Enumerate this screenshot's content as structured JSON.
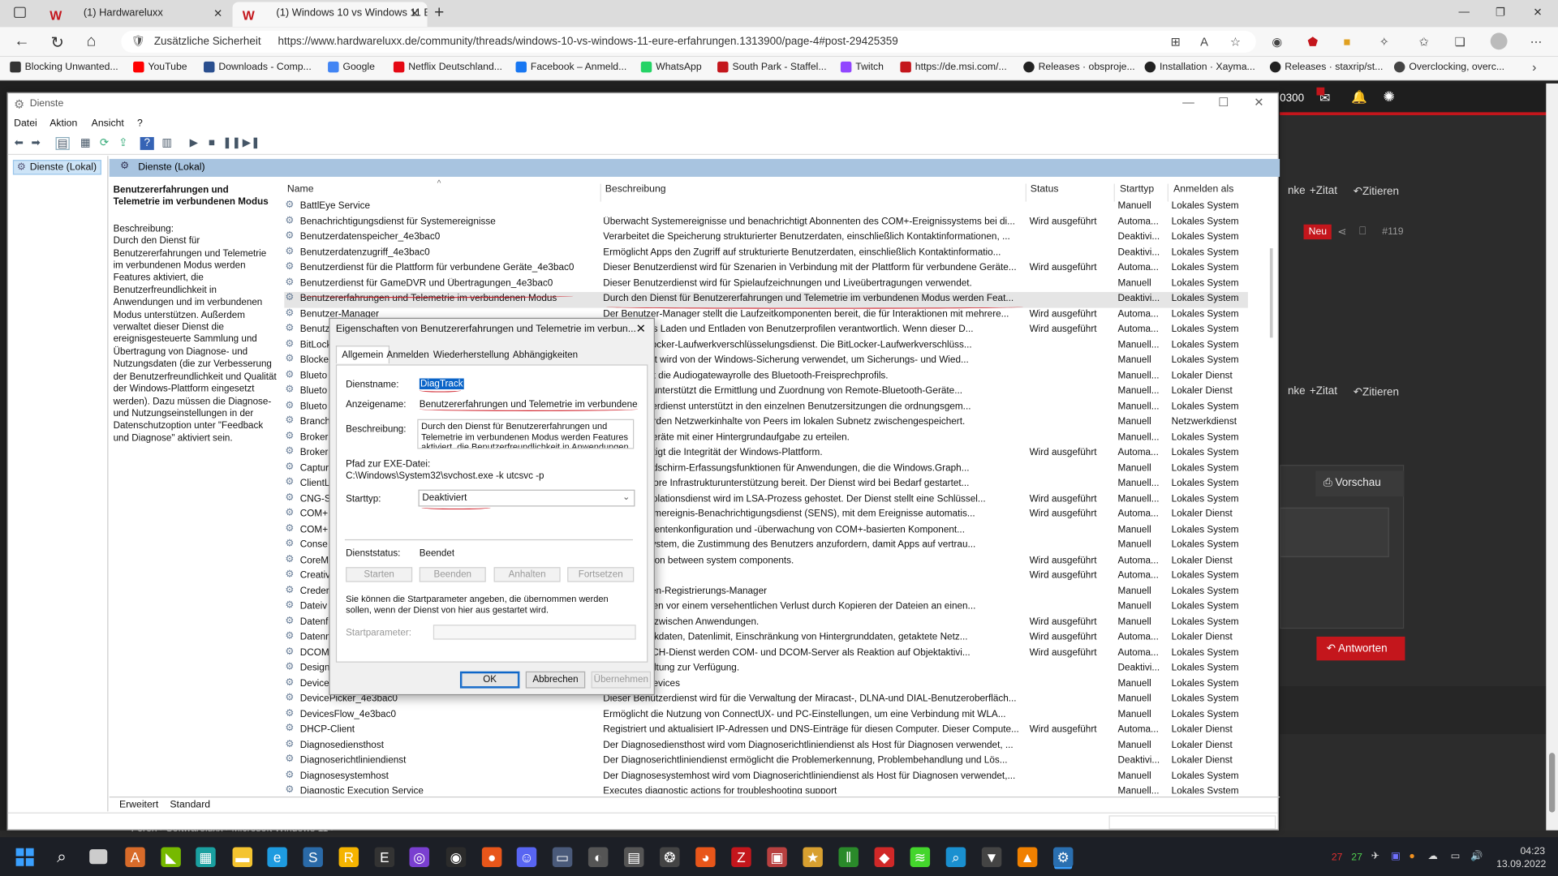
{
  "browser": {
    "tabs": [
      {
        "label": "(1) Hardwareluxx",
        "active": false
      },
      {
        "label": "(1) Windows 10 vs Windows 11 E",
        "active": true
      }
    ],
    "security_label": "Zusätzliche Sicherheit",
    "url": "https://www.hardwareluxx.de/community/threads/windows-10-vs-windows-11-eure-erfahrungen.1313900/page-4#post-29425359",
    "bookmarks": [
      {
        "label": "Blocking Unwanted...",
        "color": "#333333"
      },
      {
        "label": "YouTube",
        "color": "#ff0000"
      },
      {
        "label": "Downloads - Comp...",
        "color": "#2a4f8f"
      },
      {
        "label": "Google",
        "color": "#4285f4"
      },
      {
        "label": "Netflix Deutschland...",
        "color": "#e50914"
      },
      {
        "label": "Facebook – Anmeld...",
        "color": "#1877f2"
      },
      {
        "label": "WhatsApp",
        "color": "#25d366"
      },
      {
        "label": "South Park - Staffel...",
        "color": "#c4161c"
      },
      {
        "label": "Twitch",
        "color": "#9146ff"
      },
      {
        "label": "https://de.msi.com/...",
        "color": "#c4161c"
      },
      {
        "label": "Releases · obsproje...",
        "color": "#222222"
      },
      {
        "label": "Installation · Xayma...",
        "color": "#222222"
      },
      {
        "label": "Releases · staxrip/st...",
        "color": "#222222"
      },
      {
        "label": "Overclocking, overc...",
        "color": "#444444"
      }
    ]
  },
  "webpage": {
    "counter": "0300",
    "quote_label": "Zitat",
    "cite_label": "Zitieren",
    "partial_label": "nke",
    "new_badge": "Neu",
    "post_number": "#119",
    "preview_label": "Vorschau",
    "reply_label": "Antworten",
    "breadcrumb": "Foren  ›  Softwareluxx  ›  Microsoft Windows 11  ›"
  },
  "services": {
    "window_title": "Dienste",
    "menu": [
      "Datei",
      "Aktion",
      "Ansicht",
      "?"
    ],
    "tree_node": "Dienste (Lokal)",
    "pane_header": "Dienste (Lokal)",
    "selected_title": "Benutzererfahrungen und Telemetrie im verbundenen Modus",
    "description_label": "Beschreibung:",
    "description": "Durch den Dienst für Benutzererfahrungen und Telemetrie im verbundenen Modus werden Features aktiviert, die Benutzerfreundlichkeit in Anwendungen und im verbundenen Modus unterstützen. Außerdem verwaltet dieser Dienst die ereignisgesteuerte Sammlung und Übertragung von Diagnose- und Nutzungsdaten (die zur Verbesserung der Benutzerfreundlichkeit und Qualität der Windows-Plattform eingesetzt werden). Dazu müssen die Diagnose- und Nutzungseinstellungen in der Datenschutzoption unter \"Feedback und Diagnose\" aktiviert sein.",
    "columns": [
      "Name",
      "Beschreibung",
      "Status",
      "Starttyp",
      "Anmelden als"
    ],
    "rows": [
      {
        "name": "BattlEye Service",
        "desc": "",
        "status": "",
        "start": "Manuell",
        "logon": "Lokales System"
      },
      {
        "name": "Benachrichtigungsdienst für Systemereignisse",
        "desc": "Überwacht Systemereignisse und benachrichtigt Abonnenten des COM+-Ereignissystems bei di...",
        "status": "Wird ausgeführt",
        "start": "Automa...",
        "logon": "Lokales System"
      },
      {
        "name": "Benutzerdatenspeicher_4e3bac0",
        "desc": "Verarbeitet die Speicherung strukturierter Benutzerdaten, einschließlich Kontaktinformationen, ...",
        "status": "",
        "start": "Deaktivi...",
        "logon": "Lokales System"
      },
      {
        "name": "Benutzerdatenzugriff_4e3bac0",
        "desc": "Ermöglicht Apps den Zugriff auf strukturierte Benutzerdaten, einschließlich Kontaktinformatio...",
        "status": "",
        "start": "Deaktivi...",
        "logon": "Lokales System"
      },
      {
        "name": "Benutzerdienst für die Plattform für verbundene Geräte_4e3bac0",
        "desc": "Dieser Benutzerdienst wird für Szenarien in Verbindung mit der Plattform für verbundene Geräte...",
        "status": "Wird ausgeführt",
        "start": "Automa...",
        "logon": "Lokales System"
      },
      {
        "name": "Benutzerdienst für GameDVR und Übertragungen_4e3bac0",
        "desc": "Dieser Benutzerdienst wird für Spielaufzeichnungen und Liveübertragungen verwendet.",
        "status": "",
        "start": "Manuell",
        "logon": "Lokales System"
      },
      {
        "name": "Benutzererfahrungen und Telemetrie im verbundenen Modus",
        "desc": "Durch den Dienst für Benutzererfahrungen und Telemetrie im verbundenen Modus werden Feat...",
        "status": "",
        "start": "Deaktivi...",
        "logon": "Lokales System",
        "selected": true
      },
      {
        "name": "Benutzer-Manager",
        "desc": "Der Benutzer-Manager stellt die Laufzeitkomponenten bereit, die für Interaktionen mit mehrere...",
        "status": "Wird ausgeführt",
        "start": "Automa...",
        "logon": "Lokales System"
      },
      {
        "name": "Benutz",
        "desc": "...t ist für das Laden und Entladen von Benutzerprofilen verantwortlich. Wenn dieser D...",
        "status": "Wird ausgeführt",
        "start": "Automa...",
        "logon": "Lokales System"
      },
      {
        "name": "BitLock",
        "desc": "...t den BitLocker-Laufwerkverschlüsselungsdienst. Die BitLocker-Laufwerkverschlüss...",
        "status": "",
        "start": "Manuell...",
        "logon": "Lokales System"
      },
      {
        "name": "Blocke",
        "desc": "...INE-Dienst wird von der Windows-Sicherung verwendet, um Sicherungs- und Wied...",
        "status": "",
        "start": "Manuell",
        "logon": "Lokales System"
      },
      {
        "name": "Blueto",
        "desc": "...unterstützt die Audiogatewayrolle des Bluetooth-Freisprechprofils.",
        "status": "",
        "start": "Manuell...",
        "logon": "Lokaler Dienst"
      },
      {
        "name": "Blueto",
        "desc": "...th-Dienst unterstützt die Ermittlung und Zuordnung von Remote-Bluetooth-Geräte...",
        "status": "",
        "start": "Manuell...",
        "logon": "Lokaler Dienst"
      },
      {
        "name": "Blueto",
        "desc": "...th-Benutzerdienst unterstützt in den einzelnen Benutzersitzungen die ordnungsgem...",
        "status": "",
        "start": "Manuell...",
        "logon": "Lokales System"
      },
      {
        "name": "Branch",
        "desc": "...Dienst werden Netzwerkinhalte von Peers im lokalen Subnetz zwischengespeichert.",
        "status": "",
        "start": "Manuell",
        "logon": "Netzwerkdienst"
      },
      {
        "name": "Broker",
        "desc": "...s Apps, Geräte mit einer Hintergrundaufgabe zu erteilen.",
        "status": "",
        "start": "Manuell...",
        "logon": "Lokales System"
      },
      {
        "name": "Broker",
        "desc": "...und bestätigt die Integrität der Windows-Plattform.",
        "status": "Wird ausgeführt",
        "start": "Automa...",
        "logon": "Lokales System"
      },
      {
        "name": "Captur",
        "desc": "...tionale Bildschirm-Erfassungsfunktionen für Anwendungen, die die Windows.Graph...",
        "status": "",
        "start": "Manuell",
        "logon": "Lokales System"
      },
      {
        "name": "ClientL",
        "desc": "...icrosoft Store Infrastrukturunterstützung bereit. Der Dienst wird bei Bedarf gestartet...",
        "status": "",
        "start": "Manuell...",
        "logon": "Lokales System"
      },
      {
        "name": "CNG-S",
        "desc": "...chlüsselisolationsdienst wird im LSA-Prozess gehostet. Der Dienst stellt eine Schlüssel...",
        "status": "Wird ausgeführt",
        "start": "Manuell...",
        "logon": "Lokales System"
      },
      {
        "name": "COM+",
        "desc": "...den Systemereignis-Benachrichtigungsdienst (SENS), mit dem Ereignisse automatis...",
        "status": "Wird ausgeführt",
        "start": "Automa...",
        "logon": "Lokaler Dienst"
      },
      {
        "name": "COM+",
        "desc": "...e Komponentenkonfiguration und -überwachung von COM+-basierten Komponent...",
        "status": "",
        "start": "Manuell",
        "logon": "Lokales System"
      },
      {
        "name": "Conse",
        "desc": "...es dem System, die Zustimmung des Benutzers anzufordern, damit Apps auf vertrau...",
        "status": "",
        "start": "Manuell",
        "logon": "Lokales System"
      },
      {
        "name": "CoreM",
        "desc": "...mmunication between system components.",
        "status": "Wird ausgeführt",
        "start": "Automa...",
        "logon": "Lokaler Dienst"
      },
      {
        "name": "Creativ",
        "desc": "",
        "status": "Wird ausgeführt",
        "start": "Automa...",
        "logon": "Lokales System"
      },
      {
        "name": "Creder",
        "desc": "...formationen-Registrierungs-Manager",
        "status": "",
        "start": "Manuell",
        "logon": "Lokales System"
      },
      {
        "name": "Dateiv",
        "desc": "...utzerdateien vor einem versehentlichen Verlust durch Kopieren der Dateien an einen...",
        "status": "",
        "start": "Manuell",
        "logon": "Lokales System"
      },
      {
        "name": "Datenf",
        "desc": "...tenbroker zwischen Anwendungen.",
        "status": "Wird ausgeführt",
        "start": "Manuell",
        "logon": "Lokales System"
      },
      {
        "name": "Datenn",
        "desc": "...n Netzwerkdaten, Datenlimit, Einschränkung von Hintergrunddaten, getaktete Netz...",
        "status": "Wird ausgeführt",
        "start": "Automa...",
        "logon": "Lokaler Dienst"
      },
      {
        "name": "DCOM",
        "desc": "...OMLAUNCH-Dienst werden COM- und DCOM-Server als Reaktion auf Objektaktivi...",
        "status": "Wird ausgeführt",
        "start": "Automa...",
        "logon": "Lokales System"
      },
      {
        "name": "Design",
        "desc": "...signverwaltung zur Verfügung.",
        "status": "",
        "start": "Deaktivi...",
        "logon": "Lokales System"
      },
      {
        "name": "Device",
        "desc": "...s to pair devices",
        "status": "",
        "start": "Manuell",
        "logon": "Lokales System"
      },
      {
        "name": "DevicePicker_4e3bac0",
        "desc": "Dieser Benutzerdienst wird für die Verwaltung der Miracast-, DLNA-und DIAL-Benutzeroberfläch...",
        "status": "",
        "start": "Manuell",
        "logon": "Lokales System"
      },
      {
        "name": "DevicesFlow_4e3bac0",
        "desc": "Ermöglicht die Nutzung von ConnectUX- und PC-Einstellungen, um eine Verbindung mit WLA...",
        "status": "",
        "start": "Manuell",
        "logon": "Lokales System"
      },
      {
        "name": "DHCP-Client",
        "desc": "Registriert und aktualisiert IP-Adressen und DNS-Einträge für diesen Computer. Dieser Compute...",
        "status": "Wird ausgeführt",
        "start": "Automa...",
        "logon": "Lokaler Dienst"
      },
      {
        "name": "Diagnosediensthost",
        "desc": "Der Diagnosediensthost wird vom Diagnoserichtliniendienst als Host für Diagnosen verwendet, ...",
        "status": "",
        "start": "Manuell",
        "logon": "Lokaler Dienst"
      },
      {
        "name": "Diagnoserichtliniendienst",
        "desc": "Der Diagnoserichtliniendienst ermöglicht die Problemerkennung, Problembehandlung und Lös...",
        "status": "",
        "start": "Deaktivi...",
        "logon": "Lokaler Dienst"
      },
      {
        "name": "Diagnosesystemhost",
        "desc": "Der Diagnosesystemhost wird vom Diagnoserichtliniendienst als Host für Diagnosen verwendet,...",
        "status": "",
        "start": "Manuell",
        "logon": "Lokales System"
      },
      {
        "name": "Diagnostic Execution Service",
        "desc": "Executes diagnostic actions for troubleshooting support",
        "status": "",
        "start": "Manuell...",
        "logon": "Lokales System"
      }
    ],
    "bottom_tabs": [
      "Erweitert",
      "Standard"
    ]
  },
  "dialog": {
    "title": "Eigenschaften von Benutzererfahrungen und Telemetrie im verbun...",
    "tabs": [
      "Allgemein",
      "Anmelden",
      "Wiederherstellung",
      "Abhängigkeiten"
    ],
    "service_name_label": "Dienstname:",
    "service_name": "DiagTrack",
    "display_name_label": "Anzeigename:",
    "display_name": "Benutzererfahrungen und Telemetrie im verbundenen Mc",
    "description_label": "Beschreibung:",
    "description": "Durch den Dienst für Benutzererfahrungen und Telemetrie im verbundenen Modus werden Features aktiviert, die Benutzerfreundlichkeit in Anwendungen",
    "exe_path_label": "Pfad zur EXE-Datei:",
    "exe_path": "C:\\Windows\\System32\\svchost.exe -k utcsvc -p",
    "start_type_label": "Starttyp:",
    "start_type": "Deaktiviert",
    "status_label": "Dienststatus:",
    "status_value": "Beendet",
    "buttons": [
      "Starten",
      "Beenden",
      "Anhalten",
      "Fortsetzen"
    ],
    "hint": "Sie können die Startparameter angeben, die übernommen werden sollen, wenn der Dienst von hier aus gestartet wird.",
    "param_label": "Startparameter:",
    "ok": "OK",
    "cancel": "Abbrechen",
    "apply": "Übernehmen"
  },
  "taskbar": {
    "apps": [
      {
        "icon": "store-icon",
        "color": "#d86b2a",
        "glyph": "A"
      },
      {
        "icon": "nvidia-icon",
        "color": "#76b900",
        "glyph": "◣"
      },
      {
        "icon": "calculator-icon",
        "color": "#1aa0a0",
        "glyph": "▦"
      },
      {
        "icon": "explorer-icon",
        "color": "#f4c430",
        "glyph": "▬"
      },
      {
        "icon": "edge-icon",
        "color": "#1e9be0",
        "glyph": "e"
      },
      {
        "icon": "steam-icon",
        "color": "#2a6aa8",
        "glyph": "S"
      },
      {
        "icon": "rockstar-icon",
        "color": "#f5b400",
        "glyph": "R"
      },
      {
        "icon": "epic-icon",
        "color": "#333333",
        "glyph": "E"
      },
      {
        "icon": "circle-app-icon",
        "color": "#7a3fd0",
        "glyph": "◎"
      },
      {
        "icon": "origin-icon",
        "color": "#2b2b2b",
        "glyph": "◉"
      },
      {
        "icon": "firefox-alt-icon",
        "color": "#e8561a",
        "glyph": "●"
      },
      {
        "icon": "discord-icon",
        "color": "#5865f2",
        "glyph": "☺"
      },
      {
        "icon": "controller-icon",
        "color": "#4a5a7a",
        "glyph": "▭"
      },
      {
        "icon": "obs-icon",
        "color": "#555555",
        "glyph": "◐"
      },
      {
        "icon": "clapper-icon",
        "color": "#555555",
        "glyph": "▤"
      },
      {
        "icon": "aperture-icon",
        "color": "#444444",
        "glyph": "❂"
      },
      {
        "icon": "firefox-icon",
        "color": "#e8561a",
        "glyph": "◕"
      },
      {
        "icon": "filezilla-icon",
        "color": "#c4161c",
        "glyph": "Z"
      },
      {
        "icon": "calendar-icon",
        "color": "#b84040",
        "glyph": "▣"
      },
      {
        "icon": "star-app-icon",
        "color": "#d8a030",
        "glyph": "★"
      },
      {
        "icon": "bars-app-icon",
        "color": "#2a8a2a",
        "glyph": "‖"
      },
      {
        "icon": "anydesk-icon",
        "color": "#d02828",
        "glyph": "◆"
      },
      {
        "icon": "razer-icon",
        "color": "#44d62c",
        "glyph": "≋"
      },
      {
        "icon": "search-app-icon",
        "color": "#1a90d0",
        "glyph": "⌕"
      },
      {
        "icon": "wolf-icon",
        "color": "#444444",
        "glyph": "▼"
      },
      {
        "icon": "vlc-icon",
        "color": "#f08000",
        "glyph": "▲"
      },
      {
        "icon": "services-gear-icon",
        "color": "#2a6fb0",
        "glyph": "⚙"
      }
    ],
    "tray": {
      "cpu_temp": "27",
      "gpu_temp": "27",
      "time": "04:23",
      "date": "13.09.2022"
    }
  }
}
